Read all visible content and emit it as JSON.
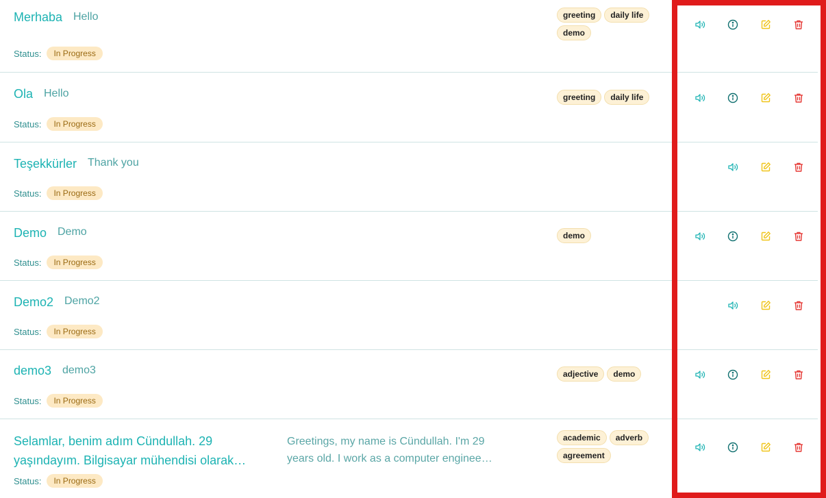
{
  "status_label": "Status:",
  "colors": {
    "teal": "#1db3b3",
    "info": "#0f6f6f",
    "edit": "#f0c419",
    "delete": "#e53935",
    "highlight": "#e01b1b"
  },
  "rows": [
    {
      "term": "Merhaba",
      "translation": "Hello",
      "status": "In Progress",
      "tags": [
        "greeting",
        "daily life",
        "demo"
      ],
      "actions": [
        "speaker-icon",
        "info-icon",
        "edit-icon",
        "trash-icon"
      ]
    },
    {
      "term": "Ola",
      "translation": "Hello",
      "status": "In Progress",
      "tags": [
        "greeting",
        "daily life"
      ],
      "actions": [
        "speaker-icon",
        "info-icon",
        "edit-icon",
        "trash-icon"
      ]
    },
    {
      "term": "Teşekkürler",
      "translation": "Thank you",
      "status": "In Progress",
      "tags": [],
      "actions": [
        "speaker-icon",
        "edit-icon",
        "trash-icon"
      ]
    },
    {
      "term": "Demo",
      "translation": "Demo",
      "status": "In Progress",
      "tags": [
        "demo"
      ],
      "actions": [
        "speaker-icon",
        "info-icon",
        "edit-icon",
        "trash-icon"
      ]
    },
    {
      "term": "Demo2",
      "translation": "Demo2",
      "status": "In Progress",
      "tags": [],
      "actions": [
        "speaker-icon",
        "edit-icon",
        "trash-icon"
      ]
    },
    {
      "term": "demo3",
      "translation": "demo3",
      "status": "In Progress",
      "tags": [
        "adjective",
        "demo"
      ],
      "actions": [
        "speaker-icon",
        "info-icon",
        "edit-icon",
        "trash-icon"
      ]
    },
    {
      "term_lines": [
        "Selamlar, benim adım Cündullah. 29",
        "yaşındayım. Bilgisayar mühendisi olarak…"
      ],
      "translation_lines": [
        "Greetings, my name is Cündullah. I'm 29",
        "years old. I work as a computer enginee…"
      ],
      "status": "In Progress",
      "tags": [
        "academic",
        "adverb",
        "agreement"
      ],
      "actions": [
        "speaker-icon",
        "info-icon",
        "edit-icon",
        "trash-icon"
      ]
    }
  ]
}
